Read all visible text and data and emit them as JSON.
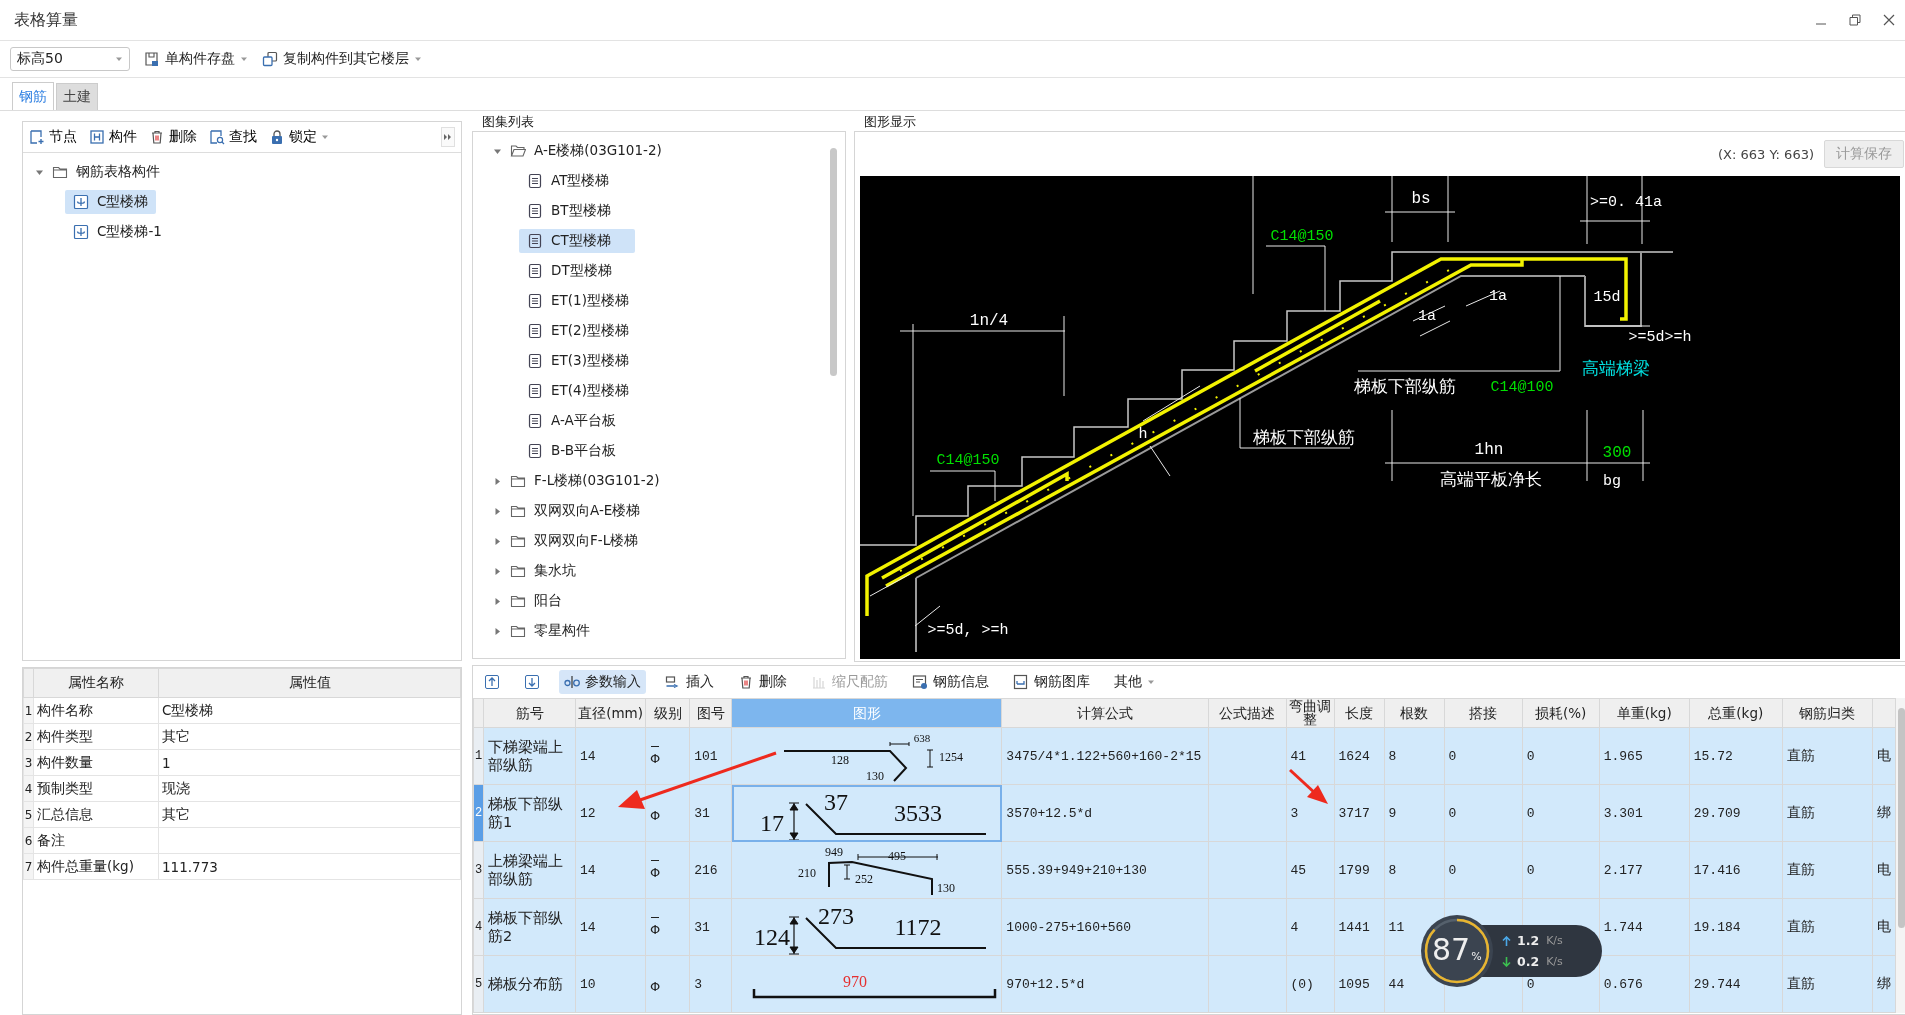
{
  "window": {
    "title": "表格算量"
  },
  "toolbar": {
    "floor": "标高50",
    "buttons": [
      {
        "label": "单构件存盘"
      },
      {
        "label": "复制构件到其它楼层"
      }
    ]
  },
  "tabs": [
    {
      "label": "钢筋",
      "selected": true
    },
    {
      "label": "土建",
      "selected": false
    }
  ],
  "component_panel": {
    "tools": [
      {
        "label": "节点",
        "dropdown": false
      },
      {
        "label": "构件",
        "dropdown": false
      },
      {
        "label": "删除",
        "dropdown": false
      },
      {
        "label": "查找",
        "dropdown": false
      },
      {
        "label": "锁定",
        "dropdown": true
      }
    ],
    "tree": [
      {
        "label": "钢筋表格构件",
        "expanded": true,
        "children": [
          {
            "label": "C型楼梯",
            "selected": true
          },
          {
            "label": "C型楼梯-1",
            "selected": false
          }
        ]
      }
    ]
  },
  "properties": {
    "columns": [
      "属性名称",
      "属性值"
    ],
    "rows": [
      {
        "index": "1",
        "name": "构件名称",
        "value": "C型楼梯"
      },
      {
        "index": "2",
        "name": "构件类型",
        "value": "其它"
      },
      {
        "index": "3",
        "name": "构件数量",
        "value": "1"
      },
      {
        "index": "4",
        "name": "预制类型",
        "value": "现浇"
      },
      {
        "index": "5",
        "name": "汇总信息",
        "value": "其它"
      },
      {
        "index": "6",
        "name": "备注"
      },
      {
        "index": "7",
        "name": "构件总重量(kg)",
        "value": "111.773"
      }
    ]
  },
  "atlas": {
    "title": "图集列表",
    "tree": [
      {
        "label": "A-E楼梯(03G101-2)",
        "expanded": true,
        "children": [
          {
            "label": "AT型楼梯",
            "selected": false
          },
          {
            "label": "BT型楼梯",
            "selected": false
          },
          {
            "label": "CT型楼梯",
            "selected": true
          },
          {
            "label": "DT型楼梯",
            "selected": false
          },
          {
            "label": "ET(1)型楼梯",
            "selected": false
          },
          {
            "label": "ET(2)型楼梯",
            "selected": false
          },
          {
            "label": "ET(3)型楼梯",
            "selected": false
          },
          {
            "label": "ET(4)型楼梯",
            "selected": false
          },
          {
            "label": "A-A平台板",
            "selected": false
          },
          {
            "label": "B-B平台板",
            "selected": false
          }
        ]
      },
      {
        "label": "F-L楼梯(03G101-2)",
        "expanded": false
      },
      {
        "label": "双网双向A-E楼梯",
        "expanded": false
      },
      {
        "label": "双网双向F-L楼梯",
        "expanded": false
      },
      {
        "label": "集水坑",
        "expanded": false
      },
      {
        "label": "阳台",
        "expanded": false
      },
      {
        "label": "零星构件",
        "expanded": false
      }
    ]
  },
  "graphic": {
    "title": "图形显示",
    "coords": "(X: 663 Y: 663)",
    "save_button": {
      "label": "计算保存",
      "disabled": true
    },
    "labels": [
      {
        "text": "bs",
        "color": "#ffffff"
      },
      {
        "text": ">=0. 41a",
        "color": "#ffffff"
      },
      {
        "text": "C14@150",
        "color": "#00e000"
      },
      {
        "text": "1n/4",
        "color": "#ffffff"
      },
      {
        "text": "1a",
        "color": "#ffffff"
      },
      {
        "text": "1a",
        "color": "#ffffff"
      },
      {
        "text": "15d",
        "color": "#ffffff"
      },
      {
        "text": ">=5d>=h",
        "color": "#ffffff"
      },
      {
        "text": "高端梯梁",
        "color": "#00e0e0"
      },
      {
        "text": "梯板下部纵筋",
        "color": "#ffffff"
      },
      {
        "text": "C14@100",
        "color": "#00e000"
      },
      {
        "text": "h",
        "color": "#ffffff"
      },
      {
        "text": "梯板下部纵筋",
        "color": "#ffffff"
      },
      {
        "text": "C14@150",
        "color": "#00e000"
      },
      {
        "text": "1hn",
        "color": "#ffffff"
      },
      {
        "text": "300",
        "color": "#00e000"
      },
      {
        "text": "高端平板净长",
        "color": "#ffffff"
      },
      {
        "text": "bg",
        "color": "#ffffff"
      },
      {
        "text": ">=5d, >=h",
        "color": "#ffffff"
      }
    ]
  },
  "rebar_table": {
    "tools": [
      {
        "active": false,
        "disabled": false
      },
      {
        "active": false,
        "disabled": false
      },
      {
        "label": "参数输入",
        "active": true,
        "disabled": false
      },
      {
        "label": "插入",
        "active": false,
        "disabled": false
      },
      {
        "label": "删除",
        "active": false,
        "disabled": false
      },
      {
        "label": "缩尺配筋",
        "active": false,
        "disabled": true
      },
      {
        "label": "钢筋信息",
        "active": false,
        "disabled": false
      },
      {
        "label": "钢筋图库",
        "active": false,
        "disabled": false
      },
      {
        "label": "其他",
        "active": false,
        "disabled": false,
        "dropdown": true
      }
    ],
    "columns": [
      {
        "label": "筋号",
        "selected": false
      },
      {
        "label": "直径(mm)",
        "selected": false
      },
      {
        "label": "级别",
        "selected": false
      },
      {
        "label": "图号",
        "selected": false
      },
      {
        "label": "图形",
        "selected": true
      },
      {
        "label": "计算公式",
        "selected": false
      },
      {
        "label": "公式描述",
        "selected": false
      },
      {
        "label": "弯曲调整",
        "selected": false
      },
      {
        "label": "长度",
        "selected": false
      },
      {
        "label": "根数",
        "selected": false
      },
      {
        "label": "搭接",
        "selected": false
      },
      {
        "label": "损耗(%)",
        "selected": false
      },
      {
        "label": "单重(kg)",
        "selected": false
      },
      {
        "label": "总重(kg)",
        "selected": false
      },
      {
        "label": "钢筋归类",
        "selected": false
      }
    ],
    "rows": [
      {
        "index": "1",
        "selected": false,
        "name": "下梯梁端上部纵筋",
        "diameter": "14",
        "grade": {
          "kind": "ribbed",
          "symbol": "Φ"
        },
        "figure": "101",
        "shape": {
          "kind": "hook",
          "labels": [
            "638",
            "128",
            "130",
            "1254"
          ]
        },
        "formula": "3475/4*1.122+560+160-2*15",
        "bend": "41",
        "length": "1624",
        "count": "8",
        "lap": "0",
        "loss": "0",
        "unit_weight": "1.965",
        "total_weight": "15.72",
        "category": "直筋",
        "column_16": "电"
      },
      {
        "index": "2",
        "selected": true,
        "name": "梯板下部纵筋1",
        "diameter": "12",
        "grade": {
          "kind": "plain",
          "symbol": "Φ"
        },
        "figure": "31",
        "shape": {
          "kind": "slope",
          "labels": [
            "17",
            "37",
            "3533"
          ]
        },
        "formula": "3570+12.5*d",
        "bend": "3",
        "length": "3717",
        "count": "9",
        "lap": "0",
        "loss": "0",
        "unit_weight": "3.301",
        "total_weight": "29.709",
        "category": "直筋",
        "column_16": "绑"
      },
      {
        "index": "3",
        "selected": false,
        "name": "上梯梁端上部纵筋",
        "diameter": "14",
        "grade": {
          "kind": "ribbed",
          "symbol": "Φ"
        },
        "figure": "216",
        "shape": {
          "kind": "crank",
          "labels": [
            "949",
            "495",
            "210",
            "252",
            "130"
          ]
        },
        "formula": "555.39+949+210+130",
        "bend": "45",
        "length": "1799",
        "count": "8",
        "lap": "0",
        "loss": "0",
        "unit_weight": "2.177",
        "total_weight": "17.416",
        "category": "直筋",
        "column_16": "电"
      },
      {
        "index": "4",
        "selected": false,
        "name": "梯板下部纵筋2",
        "diameter": "14",
        "grade": {
          "kind": "ribbed",
          "symbol": "Φ"
        },
        "figure": "31",
        "shape": {
          "kind": "slope",
          "labels": [
            "124",
            "273",
            "1172"
          ]
        },
        "formula": "1000-275+160+560",
        "bend": "4",
        "length": "1441",
        "count": "11",
        "unit_weight": "1.744",
        "total_weight": "19.184",
        "category": "直筋",
        "column_16": "电"
      },
      {
        "index": "5",
        "selected": false,
        "name": "梯板分布筋",
        "diameter": "10",
        "grade": {
          "kind": "plain",
          "symbol": "Φ"
        },
        "figure": "3",
        "shape": {
          "kind": "ubar",
          "labels": [
            "970"
          ],
          "color": "#e53030"
        },
        "formula": "970+12.5*d",
        "bend": "(0)",
        "length": "1095",
        "count": "44",
        "loss": "0",
        "unit_weight": "0.676",
        "total_weight": "29.744",
        "category": "直筋",
        "column_16": "绑"
      }
    ]
  },
  "speed_widget": {
    "percent": "87",
    "percent_unit": "%",
    "up": "1.2",
    "up_unit": "K/s",
    "down": "0.2",
    "down_unit": "K/s"
  }
}
